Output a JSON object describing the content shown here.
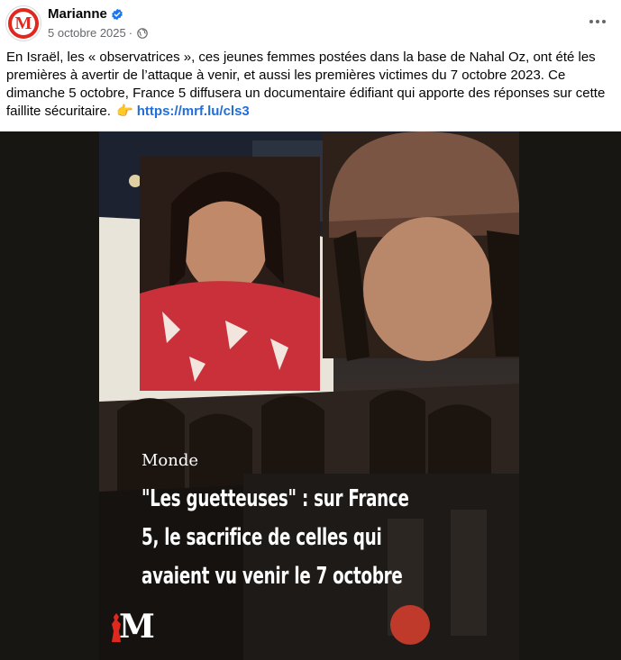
{
  "post": {
    "author": "Marianne",
    "date": "5 octobre 2025",
    "separator": "·",
    "avatar_letter": "M",
    "text_body": "En Israël, les « observatrices », ces jeunes femmes postées dans la base de Nahal Oz, ont été les premières à avertir de l’attaque à venir, et aussi les premières victimes du 7 octobre 2023. Ce dimanche 5 octobre, France 5 diffusera un documentaire édifiant qui apporte des réponses sur cette faillite sécuritaire.",
    "link": "https://mrf.lu/cls3",
    "hand_emoji": "👉"
  },
  "media": {
    "category": "Monde",
    "headline_lines": [
      "\"Les guetteuses\" : sur France",
      "5, le sacrifice de celles qui",
      "avaient vu venir le 7 octobre"
    ],
    "brand_letter": "M"
  },
  "icons": {
    "verified": "verified-badge-icon",
    "audience": "globe-icon",
    "menu": "more-options-icon"
  },
  "colors": {
    "brand_red": "#e1281f",
    "link_blue": "#216fdb",
    "verified_blue": "#1877f2",
    "meta_gray": "#65676b"
  }
}
